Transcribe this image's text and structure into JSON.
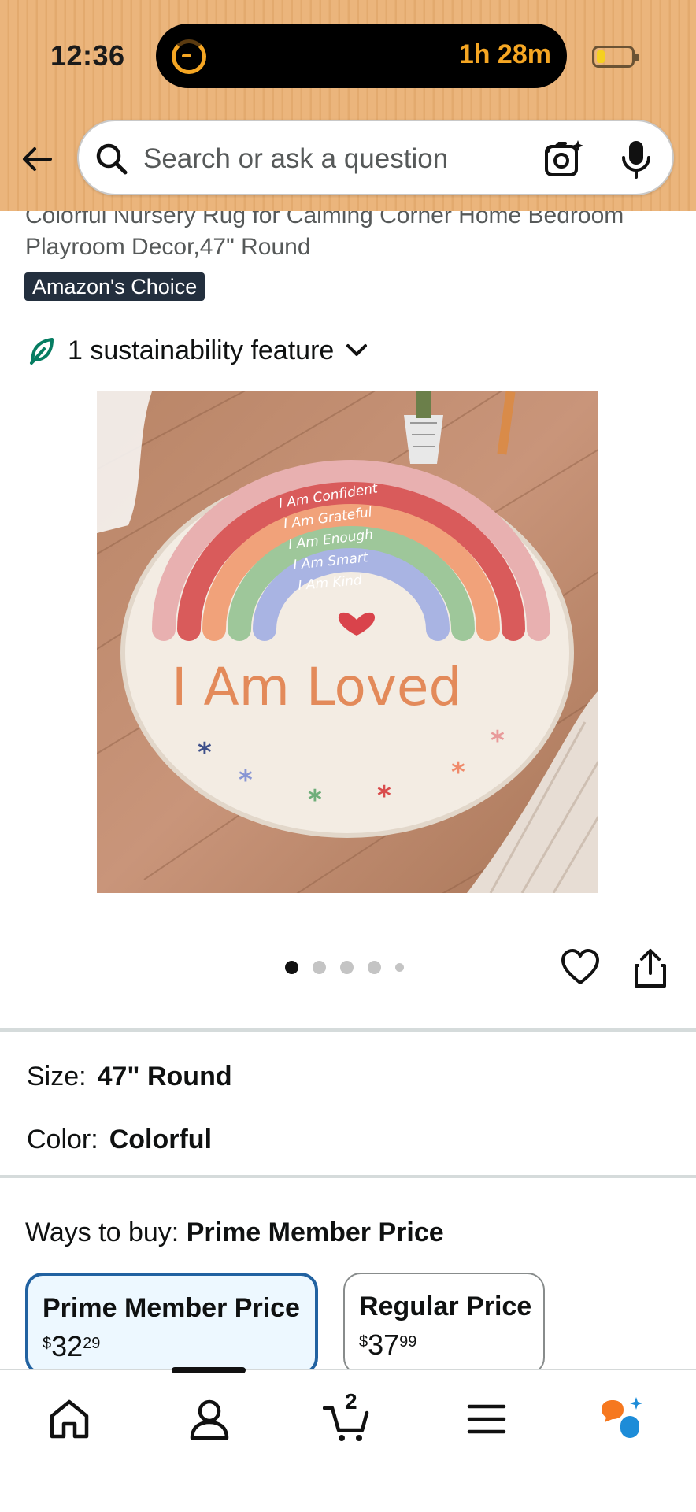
{
  "status_bar": {
    "time": "12:36",
    "timer": "1h 28m"
  },
  "search": {
    "placeholder": "Search or ask a question"
  },
  "product": {
    "title_line1": "Colorful Nursery Rug for Calming Corner Home Bedroom",
    "title_line2": "Playroom Decor,47\" Round",
    "badge": "Amazon's Choice",
    "sustainability": "1 sustainability feature",
    "image_text": {
      "line1": "I Am Confident",
      "line2": "I Am Grateful",
      "line3": "I Am Enough",
      "line4": "I Am Smart",
      "line5": "I Am Kind",
      "big": "I Am Loved"
    },
    "carousel": {
      "total_dots": 5,
      "active_index": 0
    }
  },
  "options": {
    "size_label": "Size:",
    "size_value": "47\" Round",
    "color_label": "Color:",
    "color_value": "Colorful"
  },
  "ways_to_buy": {
    "label": "Ways to buy:",
    "selected": "Prime Member Price",
    "cards": [
      {
        "label": "Prime Member Price",
        "currency": "$",
        "whole": "32",
        "fraction": "29",
        "selected": true
      },
      {
        "label": "Regular Price",
        "currency": "$",
        "whole": "37",
        "fraction": "99",
        "selected": false
      }
    ]
  },
  "bottom_nav": {
    "cart_count": "2"
  },
  "colors": {
    "accent_blue": "#2162a1",
    "header_tan": "#ebb57c",
    "badge_dark": "#232f3e",
    "leaf_green": "#067d62"
  }
}
